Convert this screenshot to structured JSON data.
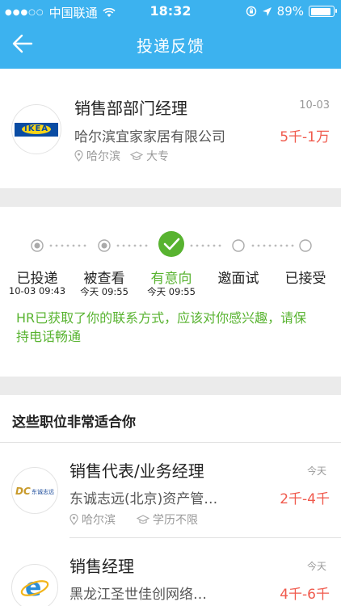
{
  "status": {
    "carrier": "中国联通",
    "time": "18:32",
    "battery": "89%"
  },
  "nav": {
    "title": "投递反馈"
  },
  "job": {
    "title": "销售部部门经理",
    "date": "10-03",
    "company": "哈尔滨宜家家居有限公司",
    "salary": "5千-1万",
    "location": "哈尔滨",
    "education": "大专",
    "logo_text": "IKEA"
  },
  "progress": {
    "steps": [
      {
        "label": "已投递",
        "time": "10-03 09:43",
        "state": "done"
      },
      {
        "label": "被查看",
        "time": "今天 09:55",
        "state": "done"
      },
      {
        "label": "有意向",
        "time": "今天 09:55",
        "state": "current"
      },
      {
        "label": "邀面试",
        "time": "",
        "state": "pending"
      },
      {
        "label": "已接受",
        "time": "",
        "state": "pending"
      }
    ],
    "message": "HR已获取了你的联系方式，应该对你感兴趣，请保持电话畅通"
  },
  "recommend": {
    "title": "这些职位非常适合你",
    "items": [
      {
        "title": "销售代表/业务经理",
        "date": "今天",
        "company": "东诚志远(北京)资产管…",
        "salary": "2千-4千",
        "location": "哈尔滨",
        "education": "学历不限",
        "logo_text": "东诚志远"
      },
      {
        "title": "销售经理",
        "date": "今天",
        "company": "黑龙江圣世佳创网络…",
        "salary": "4千-6千"
      }
    ]
  },
  "colors": {
    "header": "#3cb2ef",
    "accent_green": "#58b330",
    "salary_red": "#f05a4d"
  }
}
